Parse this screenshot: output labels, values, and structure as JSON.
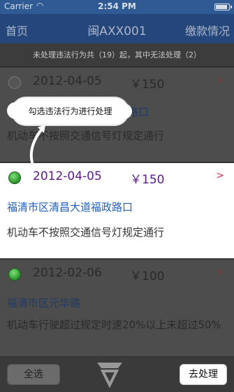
{
  "status_bar": {
    "carrier": "Carrier",
    "time": "2:54 PM",
    "battery_level": 0.9
  },
  "nav": {
    "left": "首页",
    "title": "闽AXX001",
    "right": "缴款情况"
  },
  "summary": "未处理违法行为共（19）起，其中无法处理（2）",
  "tooltip": "勾选违法行为进行处理",
  "violations": [
    {
      "date": "2012-04-05",
      "amount": "￥150",
      "address": "路口",
      "description": "机动车不按照交通信号灯规定通行",
      "selected": false
    },
    {
      "date": "2012-04-05",
      "amount": "￥150",
      "address": "福清市区清昌大道福政路口",
      "description": "机动车不按照交通信号灯规定通行",
      "selected": true
    },
    {
      "date": "2012-02-06",
      "amount": "￥100",
      "address": "福清市区元华路",
      "description": "机动车行驶超过规定时速20%以上未超过50%",
      "selected": true
    }
  ],
  "buttons": {
    "select_all": "全选",
    "go_process": "去处理"
  },
  "icons": {
    "arrow": "chevron-right-icon",
    "radio": "radio-icon",
    "wifi": "wifi-icon",
    "battery": "battery-icon"
  },
  "colors": {
    "accent": "#5b1a86",
    "link": "#1f5fbf",
    "nav": "#24467b",
    "selected": "#2c9a2c"
  }
}
